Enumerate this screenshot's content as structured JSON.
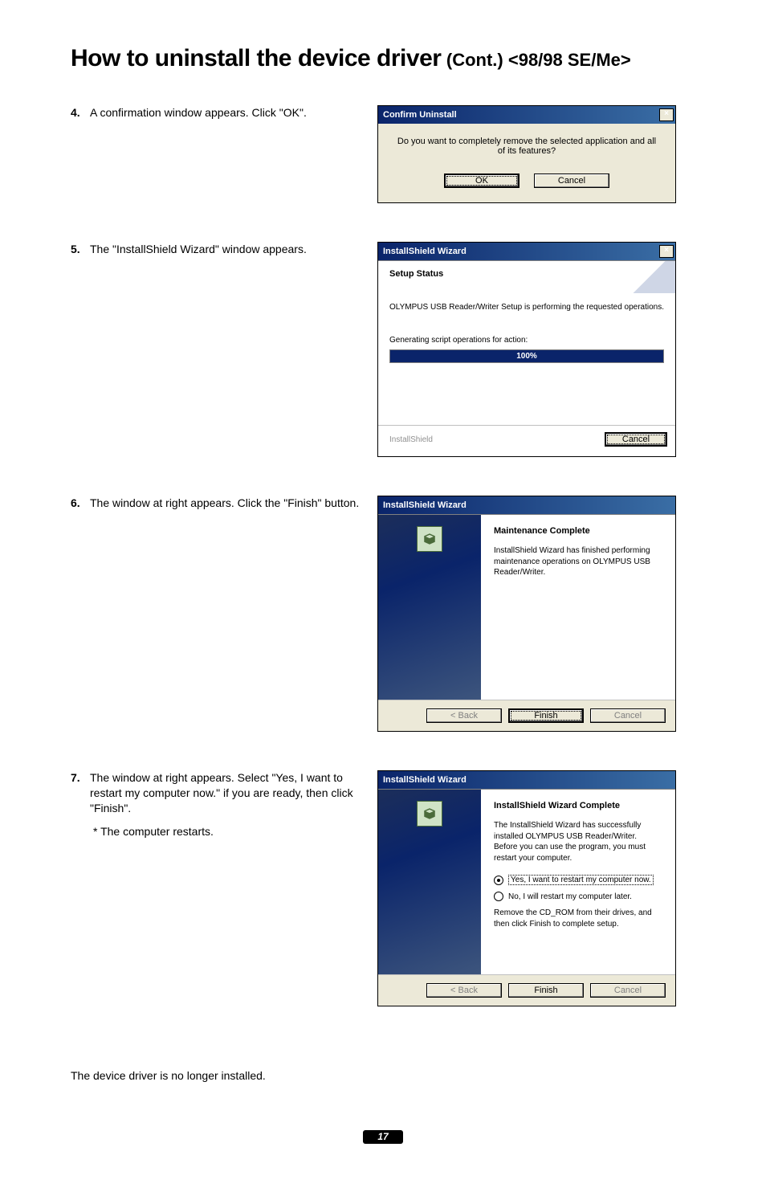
{
  "heading": {
    "main": "How to uninstall the device driver",
    "tail": "(Cont.) <98/98 SE/Me>"
  },
  "step4": {
    "num": "4.",
    "text": "A confirmation window appears. Click \"OK\".",
    "dialog": {
      "title": "Confirm Uninstall",
      "close_glyph": "×",
      "message": "Do you want to completely remove the selected application and all of its features?",
      "ok": "OK",
      "cancel": "Cancel"
    }
  },
  "step5": {
    "num": "5.",
    "text": "The \"InstallShield Wizard\" window appears.",
    "dialog": {
      "title": "InstallShield Wizard",
      "close_glyph": "×",
      "setup_status": "Setup Status",
      "line1": "OLYMPUS USB Reader/Writer Setup is performing the requested operations.",
      "line2": "Generating script operations for action:",
      "progress": "100%",
      "brand": "InstallShield",
      "cancel": "Cancel"
    }
  },
  "step6": {
    "num": "6.",
    "text": "The window at right appears. Click the \"Finish\" button.",
    "dialog": {
      "title": "InstallShield Wizard",
      "heading": "Maintenance Complete",
      "body": "InstallShield Wizard has finished performing maintenance operations on OLYMPUS USB Reader/Writer.",
      "back": "< Back",
      "finish": "Finish",
      "cancel": "Cancel"
    }
  },
  "step7": {
    "num": "7.",
    "text": "The window at right appears. Select \"Yes, I want to restart my computer now.\" if you are ready, then click \"Finish\".",
    "note": "* The computer restarts.",
    "dialog": {
      "title": "InstallShield Wizard",
      "heading": "InstallShield Wizard Complete",
      "body": "The InstallShield Wizard has successfully installed OLYMPUS USB Reader/Writer. Before you can use the program, you must restart your computer.",
      "opt_yes": "Yes, I want to restart my computer now.",
      "opt_no": "No, I will restart my computer later.",
      "tail": "Remove the CD_ROM from their drives, and then click Finish to complete setup.",
      "back": "< Back",
      "finish": "Finish",
      "cancel": "Cancel"
    }
  },
  "tail_text": "The device driver is no longer installed.",
  "page_number": "17"
}
